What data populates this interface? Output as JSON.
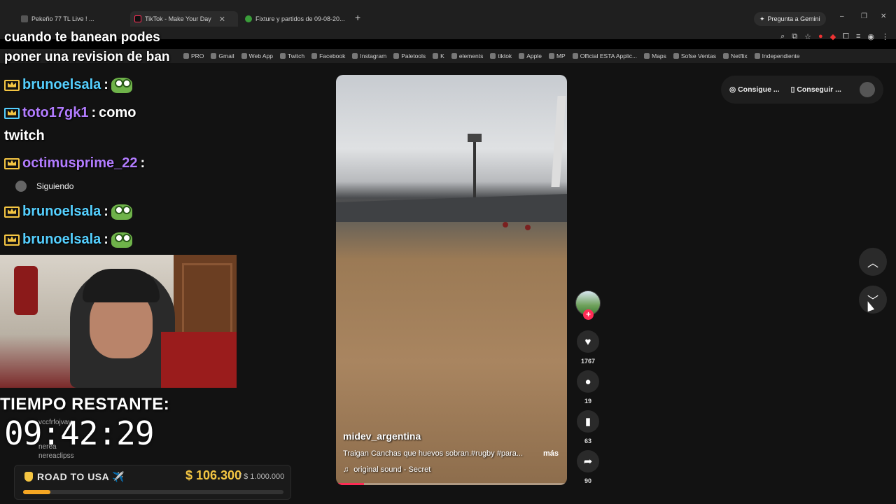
{
  "browser": {
    "tabs": [
      {
        "label": "Pekeño 77 TL Live ! ...",
        "closable": true
      },
      {
        "label": "TikTok - Make Your Day",
        "closable": true
      },
      {
        "label": "Fixture y partidos de 09-08-20...",
        "closable": true
      }
    ],
    "new_tab": "+",
    "gemini_label": "Pregunta a Gemini",
    "window_controls": [
      "–",
      "❐",
      "✕"
    ]
  },
  "bookmarks": [
    {
      "label": "PRO",
      "icon": "bookmark-icon"
    },
    {
      "label": "Gmail",
      "icon": "gmail-icon"
    },
    {
      "label": "Web App",
      "icon": "web-icon"
    },
    {
      "label": "Twitch",
      "icon": "twitch-icon"
    },
    {
      "label": "Facebook",
      "icon": "facebook-icon"
    },
    {
      "label": "Instagram",
      "icon": "instagram-icon"
    },
    {
      "label": "Paletools",
      "icon": "paletools-icon"
    },
    {
      "label": "K",
      "icon": "k-icon"
    },
    {
      "label": "elements",
      "icon": "elements-icon"
    },
    {
      "label": "tiktok",
      "icon": "tiktok-icon"
    },
    {
      "label": "Apple",
      "icon": "apple-icon"
    },
    {
      "label": "MP",
      "icon": "mp-icon"
    },
    {
      "label": "Official ESTA Applic...",
      "icon": "esta-icon"
    },
    {
      "label": "Maps",
      "icon": "maps-icon"
    },
    {
      "label": "Sofse Ventas",
      "icon": "sofse-icon"
    },
    {
      "label": "Netflix",
      "icon": "netflix-icon"
    },
    {
      "label": "Independiente",
      "icon": "independiente-icon"
    }
  ],
  "chat": {
    "top_lines": [
      "cuando te banean podes",
      "poner una revision de ban"
    ],
    "messages": [
      {
        "user": "brunoelsala",
        "sep": ":",
        "text": ""
      },
      {
        "user": "toto17gk1",
        "sep": ":",
        "text": "como"
      },
      {
        "user": "",
        "sep": "",
        "text": "twitch"
      },
      {
        "user": "octimusprime_22",
        "sep": ":",
        "text": ""
      },
      {
        "user": "brunoelsala",
        "sep": ":",
        "text": ""
      },
      {
        "user": "brunoelsala",
        "sep": ":",
        "text": ""
      }
    ]
  },
  "sidebar": {
    "following_label": "Siguiendo"
  },
  "stream": {
    "tiempo_label": "TIEMPO RESTANTE:",
    "timer": "09:42:29",
    "ghost_users": [
      {
        "name": "vccfrfojvay"
      },
      {
        "name": "nerea",
        "handle": "nereaclipss"
      }
    ],
    "road": {
      "label": "ROAD TO USA ✈️",
      "amount": "$ 106.300",
      "goal": "/ $ 1.000.000",
      "progress_fraction": 0.106
    }
  },
  "video": {
    "username": "midev_argentina",
    "description": "Traigan Canchas que huevos sobran.#rugby #para...",
    "more_label": "más",
    "sound": "original sound - Secret",
    "progress_fraction": 0.12
  },
  "actions": {
    "likes": "1767",
    "comments": "19",
    "saves": "63",
    "shares": "90"
  },
  "promo": {
    "item1": "Consigue ...",
    "item2": "Conseguir ..."
  },
  "nav": {
    "up": "︿",
    "down": "﹀"
  },
  "colors": {
    "accent": "#fe2c55",
    "gold": "#f4c542",
    "cyan": "#55d0ff",
    "purple": "#b27cff"
  }
}
